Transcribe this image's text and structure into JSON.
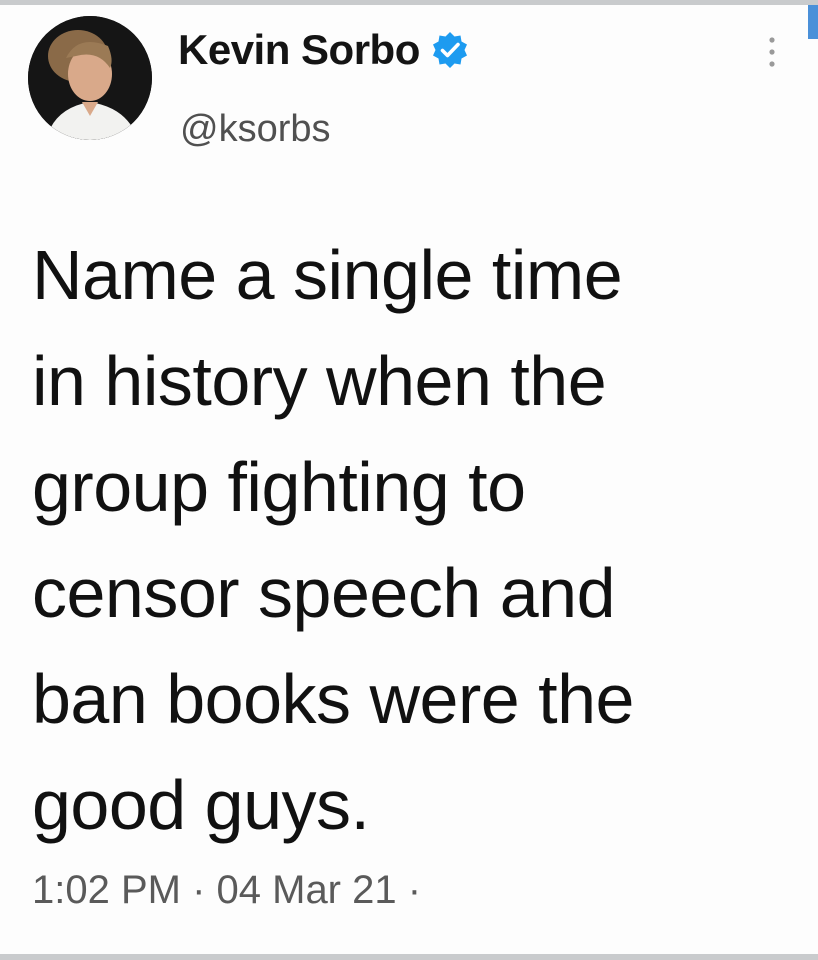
{
  "tweet": {
    "author": {
      "display_name": "Kevin Sorbo",
      "handle": "@ksorbs",
      "verified": true,
      "verified_icon": "verified-badge-icon"
    },
    "text_lines": [
      "Name a single time",
      "in history when the",
      "group fighting to",
      "censor speech and",
      "ban books were the",
      "good guys."
    ],
    "timestamp": "1:02 PM · 04 Mar 21 ·"
  },
  "colors": {
    "verified_blue": "#1d9bf0",
    "text": "#111111",
    "secondary_text": "#505050",
    "background": "#fdfdfd"
  },
  "icons": {
    "menu": "more-options-icon"
  }
}
